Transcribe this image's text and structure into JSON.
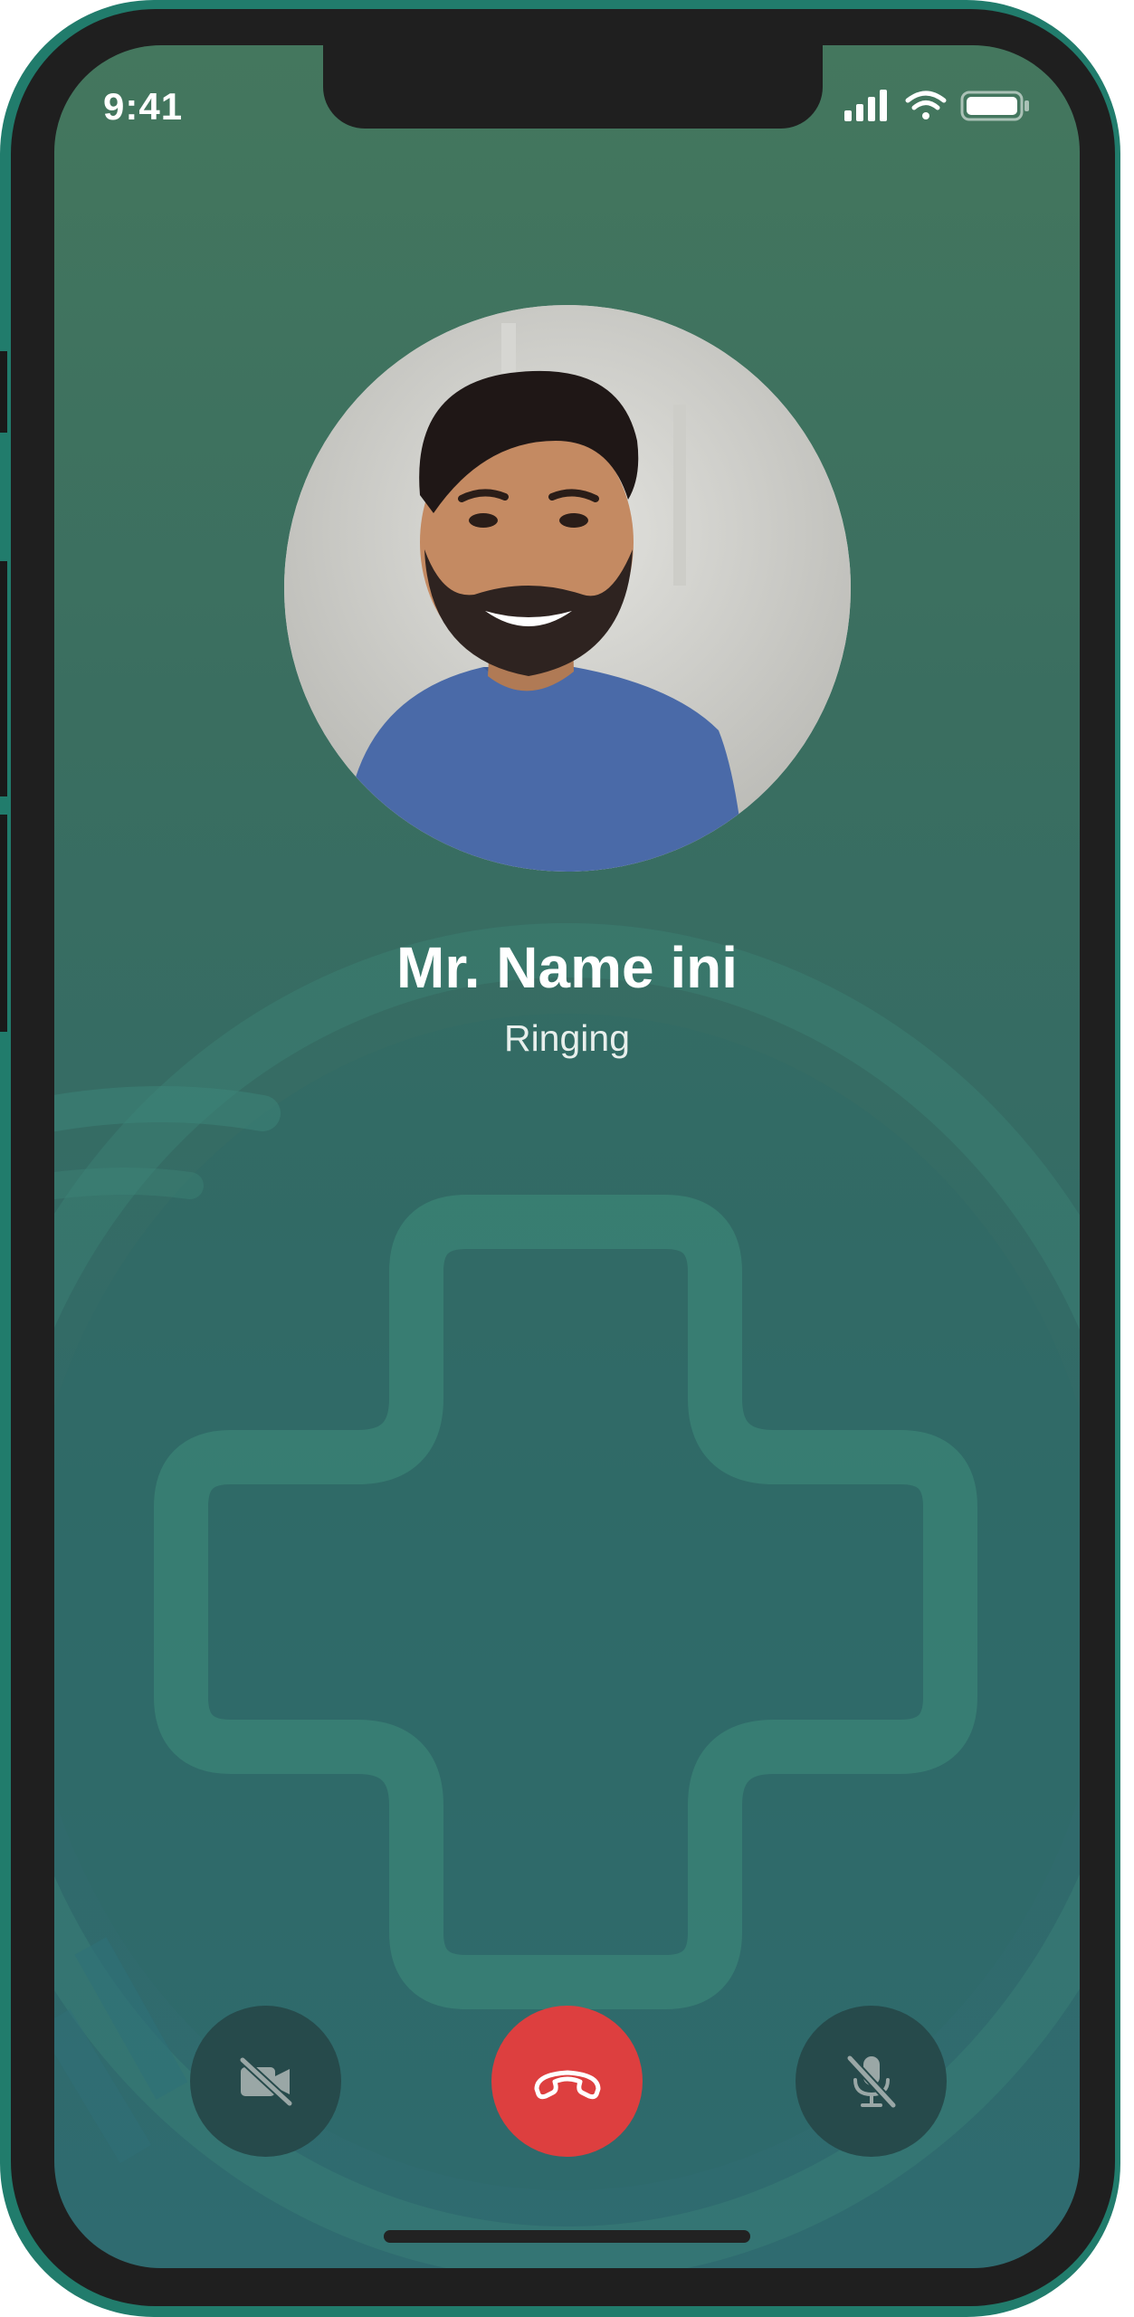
{
  "status_bar": {
    "time": "9:41",
    "icons": [
      "signal-icon",
      "wifi-icon",
      "battery-icon"
    ]
  },
  "call": {
    "caller_name": "Mr. Name ini",
    "status": "Ringing"
  },
  "controls": [
    {
      "name": "video-off-button",
      "icon": "video-off-icon"
    },
    {
      "name": "end-call-button",
      "icon": "phone-hangup-icon"
    },
    {
      "name": "mute-button",
      "icon": "mic-off-icon"
    }
  ],
  "colors": {
    "frame_accent": "#217c6c",
    "end_call": "#dd3f3f",
    "control_bg": "#264a4b",
    "background_top": "#44775e",
    "background_bottom": "#2f6b70"
  }
}
